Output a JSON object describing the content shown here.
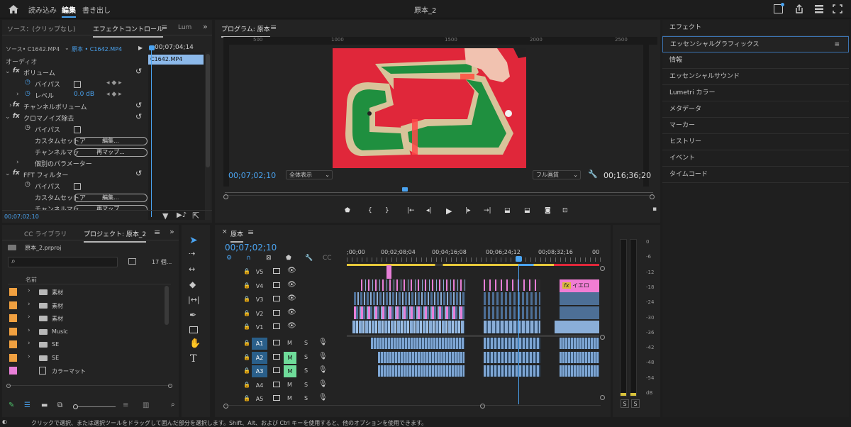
{
  "topbar": {
    "home_icon": "home-icon",
    "tabs": [
      "読み込み",
      "編集",
      "書き出し"
    ],
    "active_tab": "編集",
    "project_name": "原本_2"
  },
  "effect_controls": {
    "tab_source": "ソース：(クリップなし)",
    "tab_effect": "エフェクトコントロール",
    "tab_lum": "Lum",
    "source_label": "ソース• C1642.MP4",
    "sequence_label": "原本 • C1642.MP4",
    "timecode_head": "00;07;04;14",
    "clip_name": "C1642.MP4",
    "section_audio": "オーディオ",
    "volume": "ボリューム",
    "bypass": "バイパス",
    "level": "レベル",
    "level_value": "0.0 dB",
    "channel_volume": "チャンネルボリューム",
    "chroma_noise": "クロマノイズ除去",
    "custom_setup": "カスタムセットア",
    "edit_btn": "編集...",
    "channel_map": "チャンネルマッ",
    "remap_btn": "再マップ...",
    "individual_params": "個別のパラメーター",
    "fft_filter": "FFT フィルター",
    "bottom_timecode": "00;07;02;10"
  },
  "program": {
    "title": "プログラム: 原本",
    "ruler_labels": [
      "500",
      "1000",
      "1500",
      "2000",
      "2500"
    ],
    "timecode": "00;07;02;10",
    "zoom": "全体表示",
    "quality": "フル画質",
    "duration": "00;16;36;20"
  },
  "right_panel": {
    "items": [
      "エフェクト",
      "エッセンシャルグラフィックス",
      "情報",
      "エッセンシャルサウンド",
      "Lumetri カラー",
      "メタデータ",
      "マーカー",
      "ヒストリー",
      "イベント",
      "タイムコード"
    ],
    "active": "エッセンシャルグラフィックス"
  },
  "project": {
    "tab_cc": "CC ライブラリ",
    "tab_project": "プロジェクト: 原本_2",
    "file": "原本_2.prproj",
    "count": "17 個...",
    "col_name": "名前",
    "items": [
      {
        "name": "素材",
        "color": "#f0a040",
        "type": "folder"
      },
      {
        "name": "素材",
        "color": "#f0a040",
        "type": "folder"
      },
      {
        "name": "素材",
        "color": "#f0a040",
        "type": "folder"
      },
      {
        "name": "Music",
        "color": "#f0a040",
        "type": "folder"
      },
      {
        "name": "SE",
        "color": "#f0a040",
        "type": "folder"
      },
      {
        "name": "SE",
        "color": "#f0a040",
        "type": "folder"
      },
      {
        "name": "カラーマット",
        "color": "#e87fd8",
        "type": "matte"
      }
    ]
  },
  "timeline": {
    "seq_name": "原本",
    "timecode": "00;07;02;10",
    "ruler": [
      ";00;00",
      "00;02;08;04",
      "00;04;16;08",
      "00;06;24;12",
      "00;08;32;16",
      "00"
    ],
    "video_tracks": [
      "V5",
      "V4",
      "V3",
      "V2",
      "V1"
    ],
    "audio_tracks": [
      "A1",
      "A2",
      "A3",
      "A4",
      "A5"
    ],
    "mute": "M",
    "solo": "S",
    "title_clip": "イエロ",
    "fx": "fx"
  },
  "meter": {
    "scale": [
      "0",
      "-6",
      "-12",
      "-18",
      "-24",
      "-30",
      "-36",
      "-42",
      "-48",
      "-54",
      "dB"
    ],
    "solo_left": "S",
    "solo_right": "S"
  },
  "status_bar": {
    "text": "クリックで選択、または選択ツールをドラッグして囲んだ部分を選択します。Shift、Alt、および Ctrl キーを使用すると、他のオプションを使用できます。"
  },
  "colors": {
    "accent_blue": "#4aa3f0",
    "clip_blue": "#8aaed8",
    "clip_pink": "#e87fd8",
    "audio_green": "#6fdc9a",
    "track_blue": "#2a5f8a"
  }
}
